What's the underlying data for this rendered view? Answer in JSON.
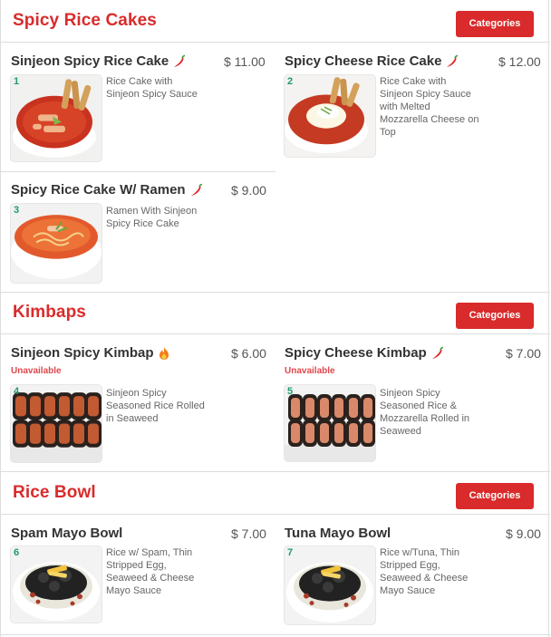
{
  "colors": {
    "accent": "#d92b2b",
    "number": "#1f9c6b",
    "unavailable": "#e0474c"
  },
  "sections": [
    {
      "title": "Spicy Rice Cakes",
      "button": "Categories",
      "items": [
        {
          "num": "1",
          "name": "Sinjeon Spicy Rice Cake",
          "price": "$ 11.00",
          "icon": "chili-pepper-icon",
          "desc": "Rice Cake with Sinjeon Spicy Sauce"
        },
        {
          "num": "2",
          "name": "Spicy Cheese Rice Cake",
          "price": "$ 12.00",
          "icon": "chili-pepper-icon",
          "desc": "Rice Cake with Sinjeon Spicy Sauce with Melted Mozzarella Cheese on Top"
        },
        {
          "num": "3",
          "name": "Spicy Rice Cake W/ Ramen",
          "price": "$ 9.00",
          "icon": "chili-pepper-icon",
          "desc": "Ramen With Sinjeon Spicy Rice Cake"
        }
      ]
    },
    {
      "title": "Kimbaps",
      "button": "Categories",
      "items": [
        {
          "num": "4",
          "name": "Sinjeon Spicy Kimbap",
          "price": "$ 6.00",
          "icon": "fire-icon",
          "status": "Unavailable",
          "desc": "Sinjeon Spicy Seasoned Rice Rolled in Seaweed"
        },
        {
          "num": "5",
          "name": "Spicy Cheese Kimbap",
          "price": "$ 7.00",
          "icon": "chili-pepper-icon",
          "status": "Unavailable",
          "desc": "Sinjeon Spicy Seasoned Rice & Mozzarella Rolled in Seaweed"
        }
      ]
    },
    {
      "title": "Rice Bowl",
      "button": "Categories",
      "items": [
        {
          "num": "6",
          "name": "Spam Mayo Bowl",
          "price": "$ 7.00",
          "desc": "Rice w/ Spam, Thin Stripped Egg, Seaweed & Cheese Mayo Sauce"
        },
        {
          "num": "7",
          "name": "Tuna Mayo Bowl",
          "price": "$ 9.00",
          "desc": "Rice w/Tuna, Thin Stripped Egg, Seaweed & Cheese Mayo Sauce"
        }
      ]
    }
  ]
}
